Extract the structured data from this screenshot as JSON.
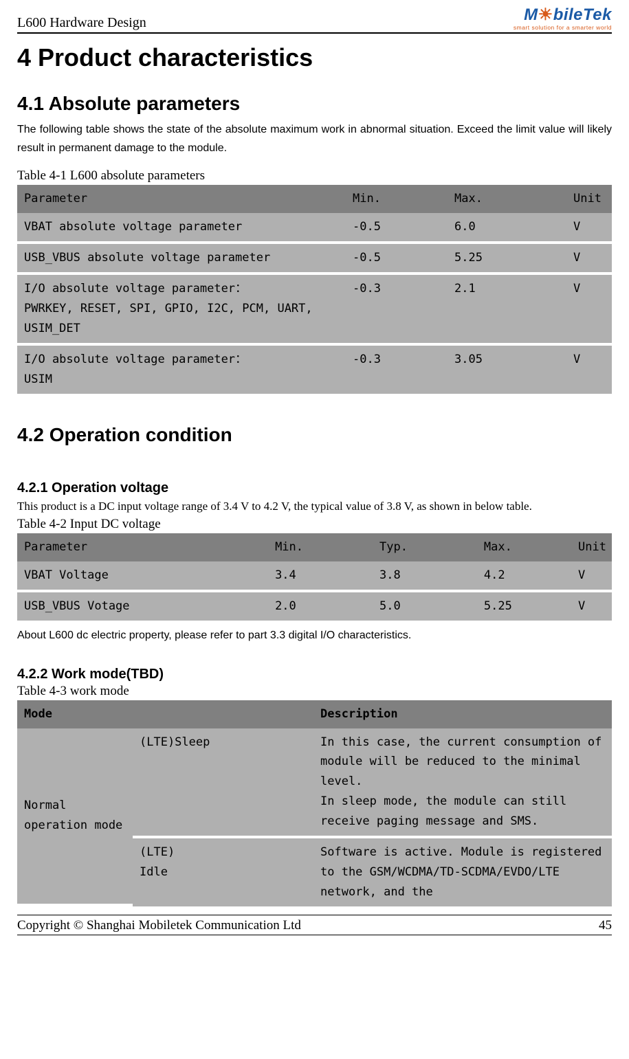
{
  "header": {
    "doc_title": "L600 Hardware Design",
    "logo_brand": "M",
    "logo_rest": "bileTek",
    "logo_tagline": "smart solution for a smarter world"
  },
  "s4": {
    "heading": "4 Product characteristics"
  },
  "s41": {
    "heading": "4.1 Absolute parameters",
    "intro": "The following table shows the state of the absolute maximum work in abnormal situation. Exceed the limit value will likely result in permanent damage to the module.",
    "table_caption": "Table 4-1 L600 absolute parameters",
    "headers": {
      "p": "Parameter",
      "min": "Min.",
      "max": "Max.",
      "unit": "Unit"
    },
    "rows": [
      {
        "p": "VBAT absolute voltage parameter",
        "min": "-0.5",
        "max": "6.0",
        "unit": "V"
      },
      {
        "p": "USB_VBUS absolute voltage parameter",
        "min": "-0.5",
        "max": "5.25",
        "unit": "V"
      },
      {
        "p": "I/O absolute voltage parameter：\nPWRKEY, RESET, SPI, GPIO, I2C, PCM, UART, USIM_DET",
        "min": "-0.3",
        "max": "2.1",
        "unit": "V"
      },
      {
        "p": "I/O absolute voltage parameter：\nUSIM",
        "min": "-0.3",
        "max": "3.05",
        "unit": "V"
      }
    ]
  },
  "s42": {
    "heading": "4.2 Operation condition"
  },
  "s421": {
    "heading": "4.2.1 Operation voltage",
    "intro": "This product is a DC input voltage range of 3.4 V to 4.2 V, the typical value of 3.8 V, as shown in below table.",
    "table_caption": "Table 4-2 Input DC voltage",
    "headers": {
      "p": "Parameter",
      "min": "Min.",
      "typ": "Typ.",
      "max": "Max.",
      "unit": "Unit"
    },
    "rows": [
      {
        "p": "VBAT Voltage",
        "min": "3.4",
        "typ": "3.8",
        "max": "4.2",
        "unit": "V"
      },
      {
        "p": "USB_VBUS Votage",
        "min": "2.0",
        "typ": "5.0",
        "max": "5.25",
        "unit": "V"
      }
    ],
    "outro": "About L600 dc electric property, please refer to part 3.3 digital I/O characteristics."
  },
  "s422": {
    "heading": "4.2.2 Work mode(TBD)",
    "table_caption": "Table 4-3 work mode",
    "headers": {
      "mode": "Mode",
      "desc": "Description"
    },
    "rows": {
      "group_label": "Normal operation mode",
      "r1": {
        "sub": "(LTE)Sleep",
        "desc": "In this case, the current consumption of module will be reduced to the minimal level.\nIn sleep mode, the module can still receive paging message and SMS."
      },
      "r2": {
        "sub": "(LTE)\nIdle",
        "desc": "Software is active. Module is registered to the GSM/WCDMA/TD-SCDMA/EVDO/LTE network, and the"
      }
    }
  },
  "footer": {
    "copyright": "Copyright © Shanghai Mobiletek Communication Ltd",
    "page": "45"
  }
}
